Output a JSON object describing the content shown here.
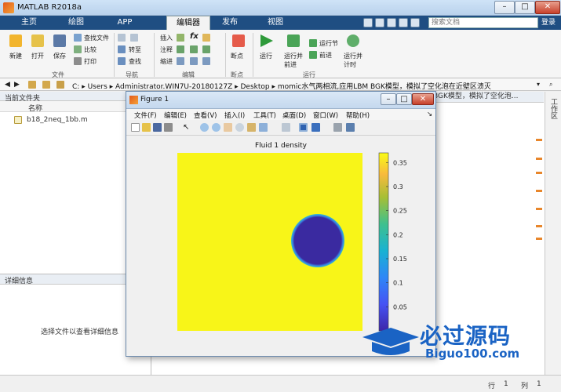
{
  "window": {
    "title": "MATLAB R2018a"
  },
  "tabs": [
    {
      "label": "主页"
    },
    {
      "label": "绘图"
    },
    {
      "label": "APP"
    },
    {
      "label": "编辑器"
    },
    {
      "label": "发布"
    },
    {
      "label": "视图"
    }
  ],
  "search": {
    "placeholder": "搜索文档",
    "login": "登录"
  },
  "ribbon": {
    "file": {
      "new": "新建",
      "open": "打开",
      "save": "保存",
      "find_files": "查找文件",
      "compare": "比较",
      "print": "打印",
      "group": "文件"
    },
    "nav": {
      "goto": "转至",
      "find": "查找",
      "group": "导航"
    },
    "edit": {
      "insert": "插入",
      "comment": "注释",
      "indent": "缩进",
      "fx": "fx",
      "group": "编辑"
    },
    "breakpoints": {
      "label": "断点",
      "group": "断点"
    },
    "run": {
      "run": "运行",
      "run_advance": "运行并\n前进",
      "run_section": "运行节",
      "advance": "前进",
      "run_time": "运行并\n计时",
      "group": "运行"
    }
  },
  "address": {
    "path": [
      "C:",
      "Users",
      "Administrator.WIN7U-20180127Z",
      "Desktop",
      "momic水气两相流,应用LBM BGK模型，模拟了空化泡在近壁区溃灭"
    ]
  },
  "left_panel": {
    "title": "当前文件夹",
    "column": "名称",
    "files": [
      "b18_2neq_1bb.m"
    ]
  },
  "detail_panel": {
    "title": "详细信息",
    "hint": "选择文件以查看详细信息"
  },
  "right_panel": {
    "title": "BGK模型，模拟了空化泡..."
  },
  "side_strip": {
    "label": "工作区"
  },
  "statusbar": {
    "row_label": "行",
    "row": "1",
    "col_label": "列",
    "col": "1"
  },
  "figure": {
    "title": "Figure 1",
    "menu": [
      "文件(F)",
      "编辑(E)",
      "查看(V)",
      "插入(I)",
      "工具(T)",
      "桌面(D)",
      "窗口(W)",
      "帮助(H)"
    ],
    "plot_title": "Fluid 1 density",
    "colorbar_ticks": [
      "0.35",
      "0.3",
      "0.25",
      "0.2",
      "0.15",
      "0.1",
      "0.05"
    ],
    "colors": {
      "background": "#f8f518",
      "bubble": "#3a2aa0",
      "bubble_edge": "#2f9fe0"
    }
  },
  "chart_data": {
    "type": "heatmap",
    "title": "Fluid 1 density",
    "colorbar": {
      "min": 0.0,
      "max": 0.37,
      "ticks": [
        0.05,
        0.1,
        0.15,
        0.2,
        0.25,
        0.3,
        0.35
      ],
      "colormap": "parula"
    },
    "field": {
      "background_value": 0.37,
      "bubble_value": 0.0
    }
  },
  "watermark": {
    "text": "必过源码",
    "url": "Biguo100.com"
  }
}
